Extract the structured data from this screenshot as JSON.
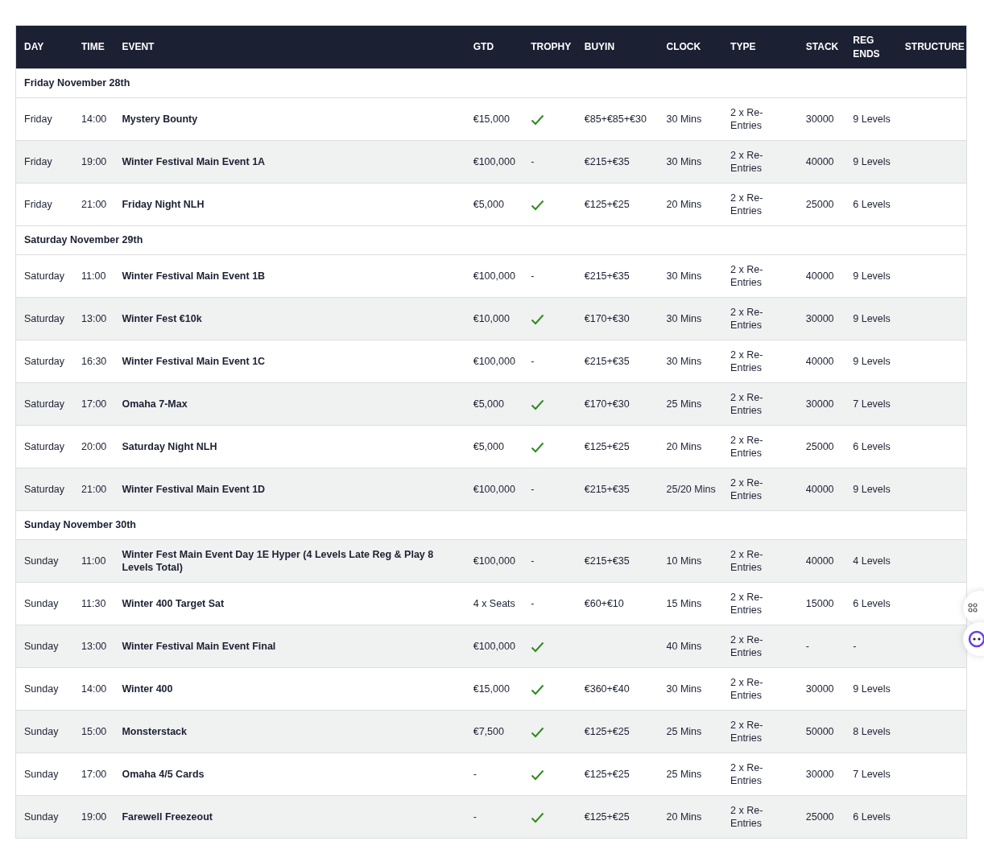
{
  "table": {
    "columns": [
      "DAY",
      "TIME",
      "EVENT",
      "GTD",
      "TROPHY",
      "BUYIN",
      "CLOCK",
      "TYPE",
      "STACK",
      "REG ENDS",
      "STRUCTURE"
    ],
    "groups": [
      {
        "date": "Friday November 28th",
        "rows": [
          {
            "day": "Friday",
            "time": "14:00",
            "event": "Mystery Bounty",
            "gtd": "€15,000",
            "trophy": true,
            "buyin": "€85+€85+€30",
            "clock": "30 Mins",
            "type": "2 x Re-Entries",
            "stack": "30000",
            "reg_ends": "9 Levels"
          },
          {
            "day": "Friday",
            "time": "19:00",
            "event": "Winter Festival Main Event 1A",
            "gtd": "€100,000",
            "trophy": false,
            "trophy_text": "-",
            "buyin": "€215+€35",
            "clock": "30 Mins",
            "type": "2 x Re-Entries",
            "stack": "40000",
            "reg_ends": "9 Levels"
          },
          {
            "day": "Friday",
            "time": "21:00",
            "event": "Friday Night NLH",
            "gtd": "€5,000",
            "trophy": true,
            "buyin": "€125+€25",
            "clock": "20 Mins",
            "type": "2 x Re-Entries",
            "stack": "25000",
            "reg_ends": "6 Levels"
          }
        ]
      },
      {
        "date": "Saturday November 29th",
        "rows": [
          {
            "day": "Saturday",
            "time": "11:00",
            "event": "Winter Festival Main Event 1B",
            "gtd": "€100,000",
            "trophy": false,
            "trophy_text": "-",
            "buyin": "€215+€35",
            "clock": "30 Mins",
            "type": "2 x Re-Entries",
            "stack": "40000",
            "reg_ends": "9 Levels"
          },
          {
            "day": "Saturday",
            "time": "13:00",
            "event": "Winter Fest €10k",
            "gtd": "€10,000",
            "trophy": true,
            "buyin": "€170+€30",
            "clock": "30 Mins",
            "type": "2 x Re-Entries",
            "stack": "30000",
            "reg_ends": "9 Levels"
          },
          {
            "day": "Saturday",
            "time": "16:30",
            "event": "Winter Festival Main Event 1C",
            "gtd": "€100,000",
            "trophy": false,
            "trophy_text": "-",
            "buyin": "€215+€35",
            "clock": "30 Mins",
            "type": "2 x Re-Entries",
            "stack": "40000",
            "reg_ends": "9 Levels"
          },
          {
            "day": "Saturday",
            "time": "17:00",
            "event": "Omaha 7-Max",
            "gtd": "€5,000",
            "trophy": true,
            "buyin": "€170+€30",
            "clock": "25 Mins",
            "type": "2 x Re-Entries",
            "stack": "30000",
            "reg_ends": "7 Levels"
          },
          {
            "day": "Saturday",
            "time": "20:00",
            "event": "Saturday Night NLH",
            "gtd": "€5,000",
            "trophy": true,
            "buyin": "€125+€25",
            "clock": "20 Mins",
            "type": "2 x Re-Entries",
            "stack": "25000",
            "reg_ends": "6 Levels"
          },
          {
            "day": "Saturday",
            "time": "21:00",
            "event": "Winter Festival Main Event 1D",
            "gtd": "€100,000",
            "trophy": false,
            "trophy_text": "-",
            "buyin": "€215+€35",
            "clock": "25/20 Mins",
            "type": "2 x Re-Entries",
            "stack": "40000",
            "reg_ends": "9 Levels"
          }
        ]
      },
      {
        "date": "Sunday November 30th",
        "rows": [
          {
            "day": "Sunday",
            "time": "11:00",
            "event": "Winter Fest Main Event Day 1E Hyper (4 Levels Late Reg & Play 8 Levels Total)",
            "gtd": "€100,000",
            "trophy": false,
            "trophy_text": "-",
            "buyin": "€215+€35",
            "clock": "10 Mins",
            "type": "2 x Re-Entries",
            "stack": "40000",
            "reg_ends": "4 Levels"
          },
          {
            "day": "Sunday",
            "time": "11:30",
            "event": "Winter 400 Target Sat",
            "gtd": "4 x Seats",
            "trophy": false,
            "trophy_text": "-",
            "buyin": "€60+€10",
            "clock": "15 Mins",
            "type": "2 x Re-Entries",
            "stack": "15000",
            "reg_ends": "6 Levels"
          },
          {
            "day": "Sunday",
            "time": "13:00",
            "event": "Winter Festival Main Event Final",
            "gtd": "€100,000",
            "trophy": true,
            "clock": "40 Mins",
            "type": "2 x Re-Entries",
            "stack": "-",
            "reg_ends": "-"
          },
          {
            "day": "Sunday",
            "time": "14:00",
            "event": "Winter 400",
            "gtd": "€15,000",
            "trophy": true,
            "buyin": "€360+€40",
            "clock": "30 Mins",
            "type": "2 x Re-Entries",
            "stack": "30000",
            "reg_ends": "9 Levels"
          },
          {
            "day": "Sunday",
            "time": "15:00",
            "event": "Monsterstack",
            "gtd": "€7,500",
            "trophy": true,
            "buyin": "€125+€25",
            "clock": "25 Mins",
            "type": "2 x Re-Entries",
            "stack": "50000",
            "reg_ends": "8 Levels"
          },
          {
            "day": "Sunday",
            "time": "17:00",
            "event": "Omaha 4/5 Cards",
            "gtd": "-",
            "trophy": true,
            "buyin": "€125+€25",
            "clock": "25 Mins",
            "type": "2 x Re-Entries",
            "stack": "30000",
            "reg_ends": "7 Levels"
          },
          {
            "day": "Sunday",
            "time": "19:00",
            "event": "Farewell Freezeout",
            "gtd": "-",
            "trophy": true,
            "buyin": "€125+€25",
            "clock": "20 Mins",
            "type": "2 x Re-Entries",
            "stack": "25000",
            "reg_ends": "6 Levels"
          }
        ]
      }
    ]
  }
}
